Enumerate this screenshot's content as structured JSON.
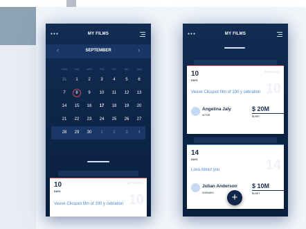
{
  "screen1": {
    "title": "MY FILMS",
    "month": "SEPTEMBER",
    "weekdays": [
      "MON",
      "TUE",
      "WED",
      "THU",
      "FRI",
      "SAT",
      "SUN"
    ],
    "weeks": [
      [
        "31",
        "1",
        "2",
        "3",
        "4",
        "5",
        "6"
      ],
      [
        "7",
        "8",
        "9",
        "10",
        "11",
        "12",
        "13"
      ],
      [
        "14",
        "15",
        "16",
        "17",
        "18",
        "19",
        "20"
      ],
      [
        "21",
        "22",
        "23",
        "24",
        "25",
        "26",
        "27"
      ],
      [
        "28",
        "29",
        "30",
        "1",
        "2",
        "3",
        "4"
      ]
    ],
    "selected_day": "8",
    "today": "17",
    "card": {
      "days": "10",
      "days_label": "DAYS",
      "status": "APPROVED",
      "film": "Veuve Clicquot film of 100 y cebration"
    }
  },
  "screen2": {
    "title": "MY FILMS",
    "card1": {
      "days": "10",
      "days_label": "DAYS",
      "status": "APPROVED",
      "film": "Veuve Clicquot film of 100 y cebration",
      "person": "Angelina Jaly",
      "role": "ACTOR",
      "amount": "$ 20M",
      "amount_label": "BUGET"
    },
    "card2": {
      "days": "14",
      "days_label": "DAYS",
      "film": "Lova About you",
      "person": "Julian Anderson",
      "role": "SCENARIO",
      "amount": "$ 10M",
      "amount_label": "BUGET"
    },
    "fab": "+"
  },
  "colors": {
    "navy": "#0c2446",
    "accent_red": "#d0434f",
    "accent_blue": "#4b86d4"
  }
}
